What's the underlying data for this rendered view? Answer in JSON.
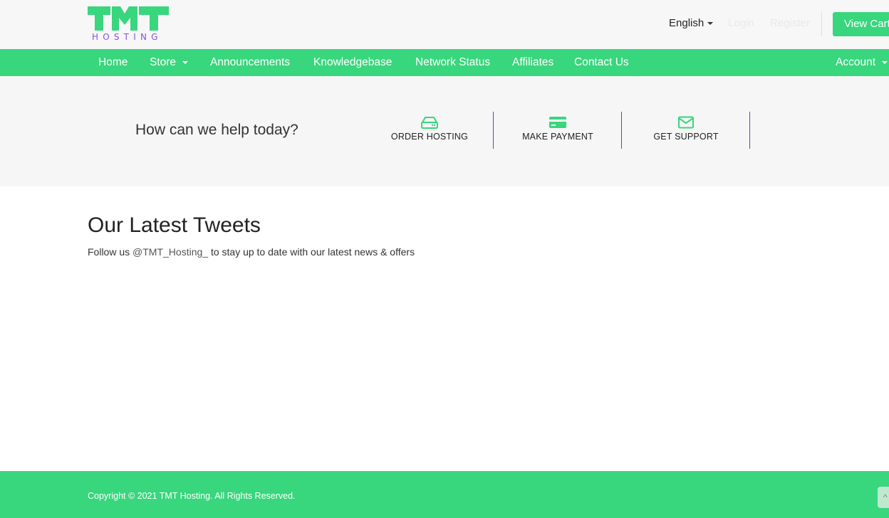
{
  "header": {
    "logo_text": "TMT",
    "logo_sub": "HOSTING",
    "language": "English",
    "login": "Login",
    "register": "Register",
    "view_cart": "View Cart",
    "brand_color": "#38d67d",
    "accent_color": "#8a52d6"
  },
  "nav": {
    "items": [
      "Home",
      "Store",
      "Announcements",
      "Knowledgebase",
      "Network Status",
      "Affiliates",
      "Contact Us"
    ],
    "account": "Account"
  },
  "help": {
    "title": "How can we help today?",
    "actions": [
      {
        "label": "ORDER HOSTING",
        "icon": "server-icon"
      },
      {
        "label": "MAKE PAYMENT",
        "icon": "credit-card-icon"
      },
      {
        "label": "GET SUPPORT",
        "icon": "envelope-icon"
      }
    ]
  },
  "tweets": {
    "title": "Our Latest Tweets",
    "prefix": "Follow us ",
    "handle": "@TMT_Hosting_",
    "suffix": " to stay up to date with our latest news & offers"
  },
  "footer": {
    "copyright": "Copyright © 2021 TMT Hosting. All Rights Reserved."
  }
}
